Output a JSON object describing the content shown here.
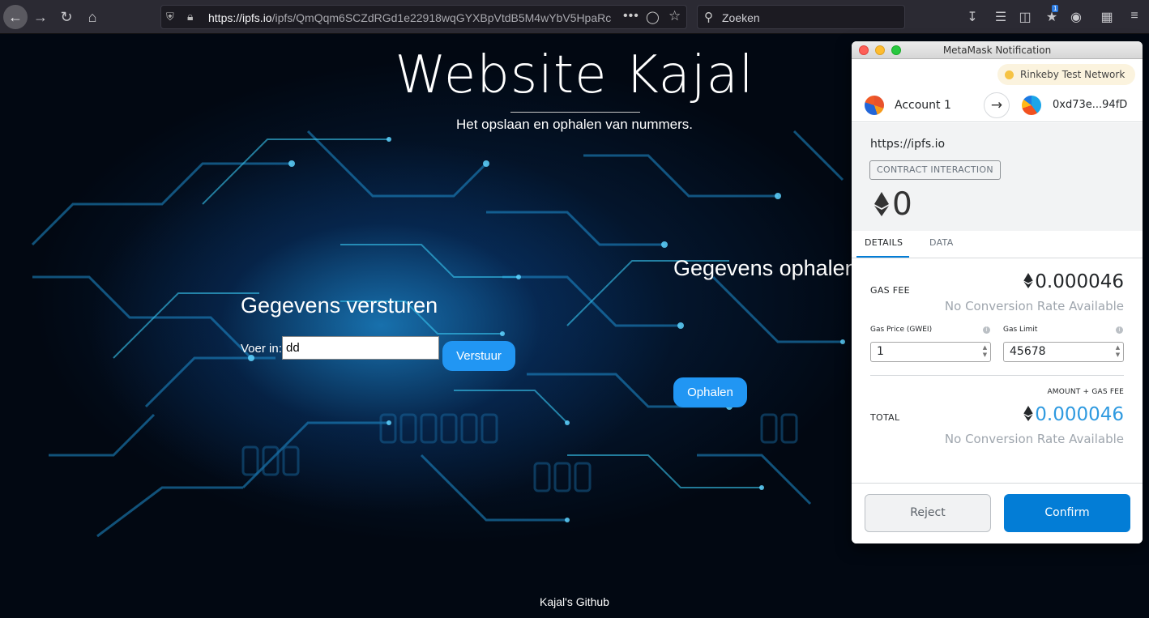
{
  "browser": {
    "url_host": "https://ipfs.io",
    "url_path": "/ipfs/QmQqm6SCZdRGd1e22918wqGYXBpVtdB5M4wYbV5HpaRc",
    "more_label": "•••",
    "search_placeholder": "Zoeken",
    "icons": [
      "back-arrow-icon",
      "forward-arrow-icon",
      "reload-icon",
      "home-icon",
      "shield-icon",
      "lock-icon",
      "pocket-icon",
      "star-icon",
      "search-icon",
      "download-icon",
      "library-icon",
      "sidebar-icon",
      "extension-icon",
      "account-icon",
      "menu-icon"
    ],
    "notification_count": "1"
  },
  "site": {
    "title": "Website Kajal",
    "subtitle": "Het opslaan en ophalen van nummers.",
    "send_heading": "Gegevens versturen",
    "fetch_heading": "Gegevens ophalen",
    "input_label": "Voer in:",
    "input_value": "dd",
    "send_button": "Verstuur",
    "fetch_button": "Ophalen",
    "footer_link": "Kajal's Github"
  },
  "metamask": {
    "window_title": "MetaMask Notification",
    "network": "Rinkeby Test Network",
    "account_name": "Account 1",
    "to_address": "0xd73e...94fD",
    "origin": "https://ipfs.io",
    "badge": "CONTRACT INTERACTION",
    "amount": "0",
    "tab_details": "DETAILS",
    "tab_data": "DATA",
    "gas_fee_label": "GAS FEE",
    "gas_fee_value": "0.000046",
    "no_conversion": "No Conversion Rate Available",
    "gas_price_label": "Gas Price (GWEI)",
    "gas_price_value": "1",
    "gas_limit_label": "Gas Limit",
    "gas_limit_value": "45678",
    "amount_gas_label": "AMOUNT + GAS FEE",
    "total_label": "TOTAL",
    "total_value": "0.000046",
    "reject_button": "Reject",
    "confirm_button": "Confirm",
    "accent_color": "#037dd6"
  }
}
